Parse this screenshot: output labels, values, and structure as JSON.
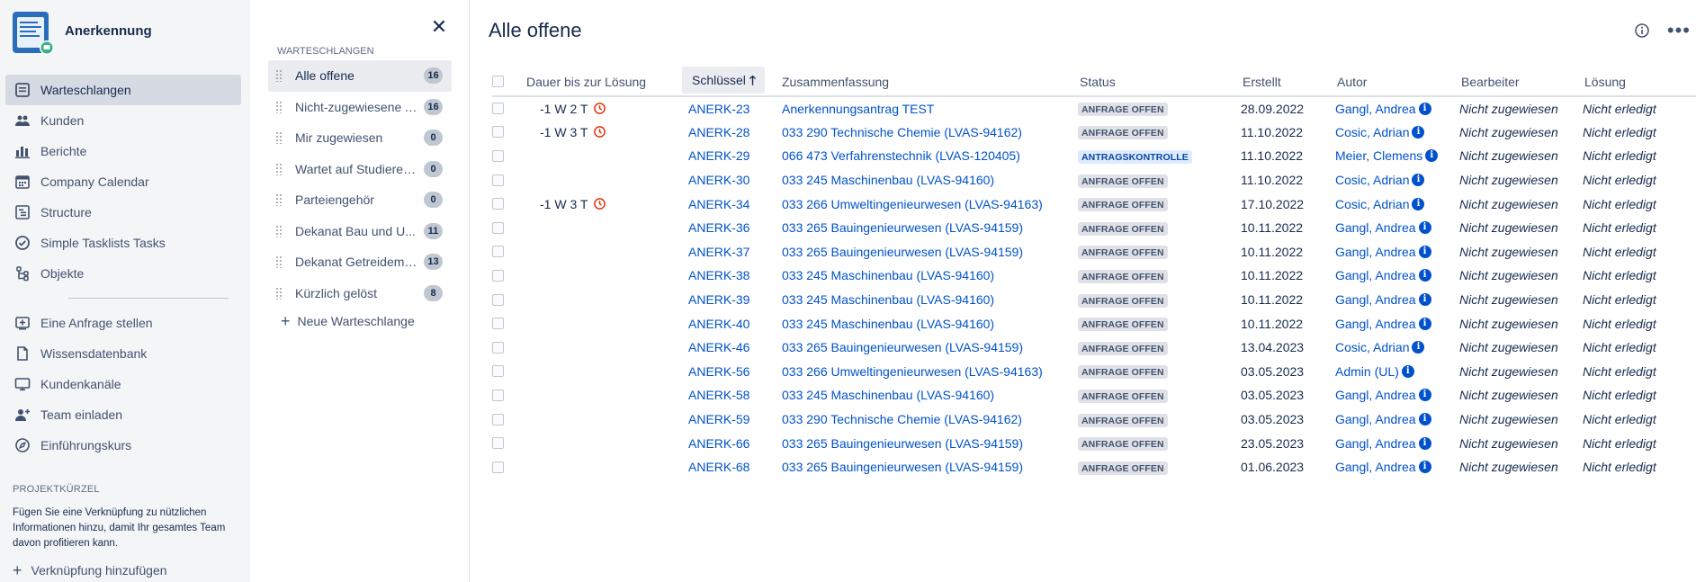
{
  "project": {
    "name": "Anerkennung"
  },
  "nav": {
    "items": [
      {
        "label": "Warteschlangen",
        "icon": "queue-icon",
        "active": true
      },
      {
        "label": "Kunden",
        "icon": "customers-icon"
      },
      {
        "label": "Berichte",
        "icon": "reports-icon"
      },
      {
        "label": "Company Calendar",
        "icon": "calendar-icon"
      },
      {
        "label": "Structure",
        "icon": "structure-icon"
      },
      {
        "label": "Simple Tasklists Tasks",
        "icon": "check-circle-icon"
      },
      {
        "label": "Objekte",
        "icon": "objects-icon"
      }
    ],
    "items2": [
      {
        "label": "Eine Anfrage stellen",
        "icon": "raise-request-icon"
      },
      {
        "label": "Wissensdatenbank",
        "icon": "document-icon"
      },
      {
        "label": "Kundenkanäle",
        "icon": "monitor-icon"
      },
      {
        "label": "Team einladen",
        "icon": "add-person-icon"
      },
      {
        "label": "Einführungskurs",
        "icon": "compass-icon"
      }
    ],
    "shortcuts_title": "PROJEKTKÜRZEL",
    "shortcuts_desc": "Fügen Sie eine Verknüpfung zu nützlichen Informationen hinzu, damit Ihr gesamtes Team davon profitieren kann.",
    "add_link": "Verknüpfung hinzufügen"
  },
  "queues": {
    "title": "WARTESCHLANGEN",
    "items": [
      {
        "label": "Alle offene",
        "count": "16",
        "active": true
      },
      {
        "label": "Nicht-zugewiesene A...",
        "count": "16"
      },
      {
        "label": "Mir zugewiesen",
        "count": "0"
      },
      {
        "label": "Wartet auf Studieren...",
        "count": "0"
      },
      {
        "label": "Parteiengehör",
        "count": "0"
      },
      {
        "label": "Dekanat Bau und U...",
        "count": "11"
      },
      {
        "label": "Dekanat Getreidemar...",
        "count": "13"
      },
      {
        "label": "Kürzlich gelöst",
        "count": "8"
      }
    ],
    "new_label": "Neue Warteschlange"
  },
  "main": {
    "title": "Alle offene",
    "columns": {
      "duration": "Dauer bis zur Lösung",
      "key": "Schlüssel",
      "summary": "Zusammenfassung",
      "status": "Status",
      "created": "Erstellt",
      "author": "Autor",
      "assignee": "Bearbeiter",
      "resolution": "Lösung"
    },
    "colors": {
      "link": "#0052cc",
      "sla_warning": "#de350b"
    },
    "rows": [
      {
        "duration": "-1 W 2 T",
        "key": "ANERK-23",
        "summary": "Anerkennungsantrag TEST",
        "status": "ANFRAGE OFFEN",
        "created": "28.09.2022",
        "author": "Gangl, Andrea",
        "assignee": "Nicht zugewiesen",
        "resolution": "Nicht erledigt"
      },
      {
        "duration": "-1 W 3 T",
        "key": "ANERK-28",
        "summary": "033 290 Technische Chemie (LVAS-94162)",
        "status": "ANFRAGE OFFEN",
        "created": "11.10.2022",
        "author": "Cosic, Adrian",
        "assignee": "Nicht zugewiesen",
        "resolution": "Nicht erledigt"
      },
      {
        "duration": "",
        "key": "ANERK-29",
        "summary": "066 473 Verfahrenstechnik (LVAS-120405)",
        "status": "ANTRAGSKONTROLLE",
        "status_blue": true,
        "created": "11.10.2022",
        "author": "Meier, Clemens",
        "assignee": "Nicht zugewiesen",
        "resolution": "Nicht erledigt"
      },
      {
        "duration": "",
        "key": "ANERK-30",
        "summary": "033 245 Maschinenbau (LVAS-94160)",
        "status": "ANFRAGE OFFEN",
        "created": "11.10.2022",
        "author": "Cosic, Adrian",
        "assignee": "Nicht zugewiesen",
        "resolution": "Nicht erledigt"
      },
      {
        "duration": "-1 W 3 T",
        "key": "ANERK-34",
        "summary": "033 266 Umweltingenieurwesen (LVAS-94163)",
        "status": "ANFRAGE OFFEN",
        "created": "17.10.2022",
        "author": "Cosic, Adrian",
        "assignee": "Nicht zugewiesen",
        "resolution": "Nicht erledigt"
      },
      {
        "duration": "",
        "key": "ANERK-36",
        "summary": "033 265 Bauingenieurwesen (LVAS-94159)",
        "status": "ANFRAGE OFFEN",
        "created": "10.11.2022",
        "author": "Gangl, Andrea",
        "assignee": "Nicht zugewiesen",
        "resolution": "Nicht erledigt"
      },
      {
        "duration": "",
        "key": "ANERK-37",
        "summary": "033 265 Bauingenieurwesen (LVAS-94159)",
        "status": "ANFRAGE OFFEN",
        "created": "10.11.2022",
        "author": "Gangl, Andrea",
        "assignee": "Nicht zugewiesen",
        "resolution": "Nicht erledigt"
      },
      {
        "duration": "",
        "key": "ANERK-38",
        "summary": "033 245 Maschinenbau (LVAS-94160)",
        "status": "ANFRAGE OFFEN",
        "created": "10.11.2022",
        "author": "Gangl, Andrea",
        "assignee": "Nicht zugewiesen",
        "resolution": "Nicht erledigt"
      },
      {
        "duration": "",
        "key": "ANERK-39",
        "summary": "033 245 Maschinenbau (LVAS-94160)",
        "status": "ANFRAGE OFFEN",
        "created": "10.11.2022",
        "author": "Gangl, Andrea",
        "assignee": "Nicht zugewiesen",
        "resolution": "Nicht erledigt"
      },
      {
        "duration": "",
        "key": "ANERK-40",
        "summary": "033 245 Maschinenbau (LVAS-94160)",
        "status": "ANFRAGE OFFEN",
        "created": "10.11.2022",
        "author": "Gangl, Andrea",
        "assignee": "Nicht zugewiesen",
        "resolution": "Nicht erledigt"
      },
      {
        "duration": "",
        "key": "ANERK-46",
        "summary": "033 265 Bauingenieurwesen (LVAS-94159)",
        "status": "ANFRAGE OFFEN",
        "created": "13.04.2023",
        "author": "Cosic, Adrian",
        "assignee": "Nicht zugewiesen",
        "resolution": "Nicht erledigt"
      },
      {
        "duration": "",
        "key": "ANERK-56",
        "summary": "033 266 Umweltingenieurwesen (LVAS-94163)",
        "status": "ANFRAGE OFFEN",
        "created": "03.05.2023",
        "author": "Admin (UL)",
        "assignee": "Nicht zugewiesen",
        "resolution": "Nicht erledigt"
      },
      {
        "duration": "",
        "key": "ANERK-58",
        "summary": "033 245 Maschinenbau (LVAS-94160)",
        "status": "ANFRAGE OFFEN",
        "created": "03.05.2023",
        "author": "Gangl, Andrea",
        "assignee": "Nicht zugewiesen",
        "resolution": "Nicht erledigt"
      },
      {
        "duration": "",
        "key": "ANERK-59",
        "summary": "033 290 Technische Chemie (LVAS-94162)",
        "status": "ANFRAGE OFFEN",
        "created": "03.05.2023",
        "author": "Gangl, Andrea",
        "assignee": "Nicht zugewiesen",
        "resolution": "Nicht erledigt"
      },
      {
        "duration": "",
        "key": "ANERK-66",
        "summary": "033 265 Bauingenieurwesen (LVAS-94159)",
        "status": "ANFRAGE OFFEN",
        "created": "23.05.2023",
        "author": "Gangl, Andrea",
        "assignee": "Nicht zugewiesen",
        "resolution": "Nicht erledigt"
      },
      {
        "duration": "",
        "key": "ANERK-68",
        "summary": "033 265 Bauingenieurwesen (LVAS-94159)",
        "status": "ANFRAGE OFFEN",
        "created": "01.06.2023",
        "author": "Gangl, Andrea",
        "assignee": "Nicht zugewiesen",
        "resolution": "Nicht erledigt"
      }
    ]
  }
}
